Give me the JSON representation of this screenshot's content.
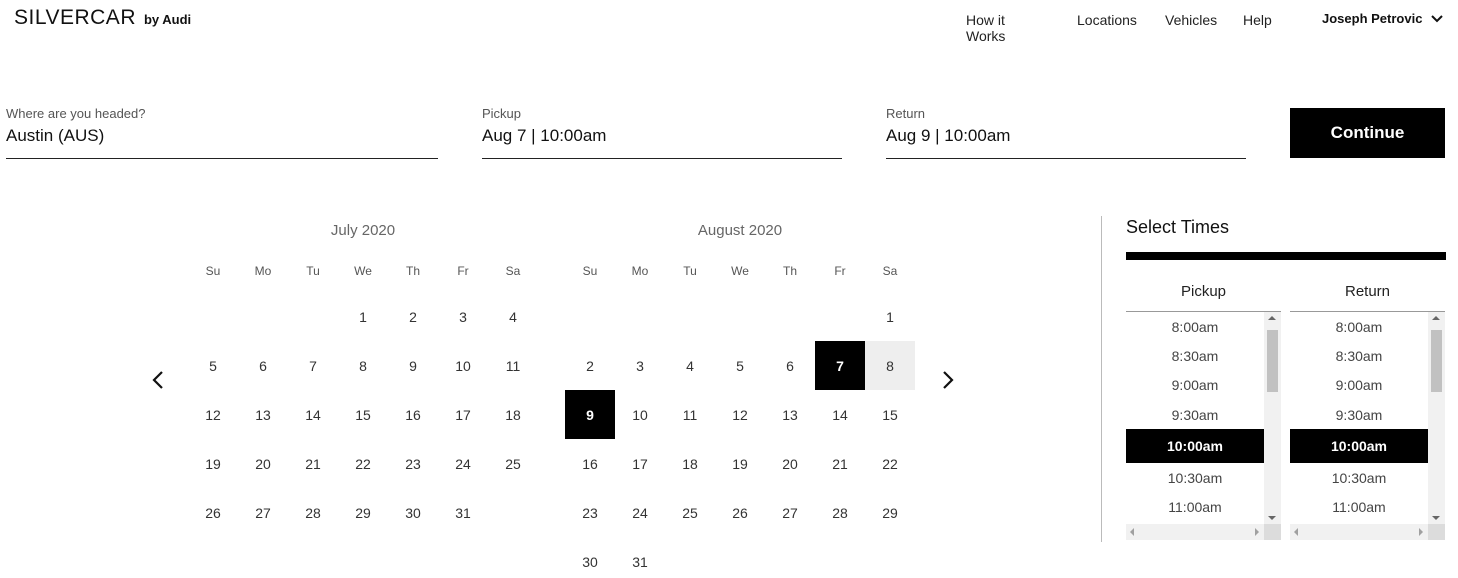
{
  "header": {
    "brand": "SILVERCAR",
    "brand_sub": "by Audi",
    "nav": [
      "How it Works",
      "Locations",
      "Vehicles",
      "Help"
    ],
    "user_name": "Joseph Petrovic"
  },
  "search": {
    "destination": {
      "label": "Where are you headed?",
      "value": "Austin (AUS)"
    },
    "pickup": {
      "label": "Pickup",
      "value": "Aug 7 | 10:00am"
    },
    "return": {
      "label": "Return",
      "value": "Aug 9 | 10:00am"
    },
    "continue_label": "Continue"
  },
  "calendar": {
    "weekdays": [
      "Su",
      "Mo",
      "Tu",
      "We",
      "Th",
      "Fr",
      "Sa"
    ],
    "months": [
      {
        "title": "July 2020",
        "cells": [
          "",
          "",
          "",
          "1",
          "2",
          "3",
          "4",
          "5",
          "6",
          "7",
          "8",
          "9",
          "10",
          "11",
          "12",
          "13",
          "14",
          "15",
          "16",
          "17",
          "18",
          "19",
          "20",
          "21",
          "22",
          "23",
          "24",
          "25",
          "26",
          "27",
          "28",
          "29",
          "30",
          "31",
          ""
        ]
      },
      {
        "title": "August 2020",
        "cells": [
          "",
          "",
          "",
          "",
          "",
          "",
          "1",
          "2",
          "3",
          "4",
          "5",
          "6",
          "7",
          "8",
          "9",
          "10",
          "11",
          "12",
          "13",
          "14",
          "15",
          "16",
          "17",
          "18",
          "19",
          "20",
          "21",
          "22",
          "23",
          "24",
          "25",
          "26",
          "27",
          "28",
          "29",
          "30",
          "31",
          "",
          "",
          "",
          "",
          ""
        ],
        "selected": [
          "7",
          "9"
        ],
        "in_range": [
          "8"
        ]
      }
    ]
  },
  "times": {
    "title": "Select Times",
    "pickup_label": "Pickup",
    "return_label": "Return",
    "options": [
      "8:00am",
      "8:30am",
      "9:00am",
      "9:30am",
      "10:00am",
      "10:30am",
      "11:00am"
    ],
    "pickup_selected": "10:00am",
    "return_selected": "10:00am"
  }
}
